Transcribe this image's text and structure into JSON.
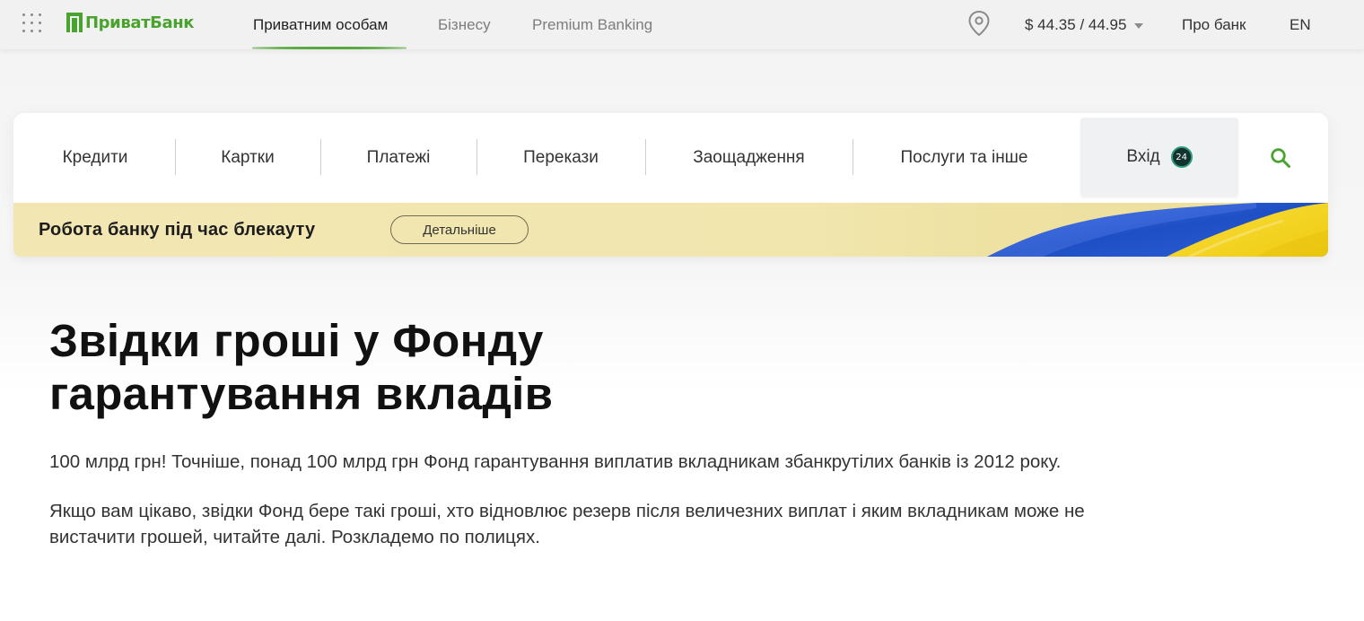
{
  "header": {
    "logo_text": "ПриватБанк",
    "nav": [
      {
        "label": "Приватним особам",
        "active": true
      },
      {
        "label": "Бізнесу",
        "active": false
      },
      {
        "label": "Premium Banking",
        "active": false
      }
    ],
    "exchange_rate": "$ 44.35 / 44.95",
    "about_label": "Про банк",
    "lang_label": "EN",
    "icons": {
      "menu": "grid-menu-icon",
      "location": "location-pin-icon",
      "rate_dropdown": "caret-down-icon"
    }
  },
  "main_nav": {
    "items": [
      "Кредити",
      "Картки",
      "Платежі",
      "Перекази",
      "Заощадження",
      "Послуги та інше"
    ],
    "login_label": "Вхід",
    "login_badge": "24",
    "search_icon": "search-icon"
  },
  "banner": {
    "title": "Робота банку під час блекауту",
    "button_label": "Детальніше"
  },
  "article": {
    "title_line1": "Звідки гроші у Фонду",
    "title_line2": "гарантування вкладів",
    "paragraph1": "100 млрд грн! Точніше, понад 100 млрд грн Фонд гарантування виплатив вкладникам збанкрутілих банків із 2012 року.",
    "paragraph2_line1": "Якщо вам цікаво, звідки Фонд бере такі гроші, хто відновлює резерв після величезних виплат і яким вкладникам може не",
    "paragraph2_line2": "вистачити грошей, читайте далі. Розкладемо по полицях."
  },
  "colors": {
    "brand_green": "#4aa22f",
    "banner_yellow": "#f2e7b3",
    "flag_blue": "#2a5bd7",
    "flag_yellow": "#f5d21c"
  }
}
